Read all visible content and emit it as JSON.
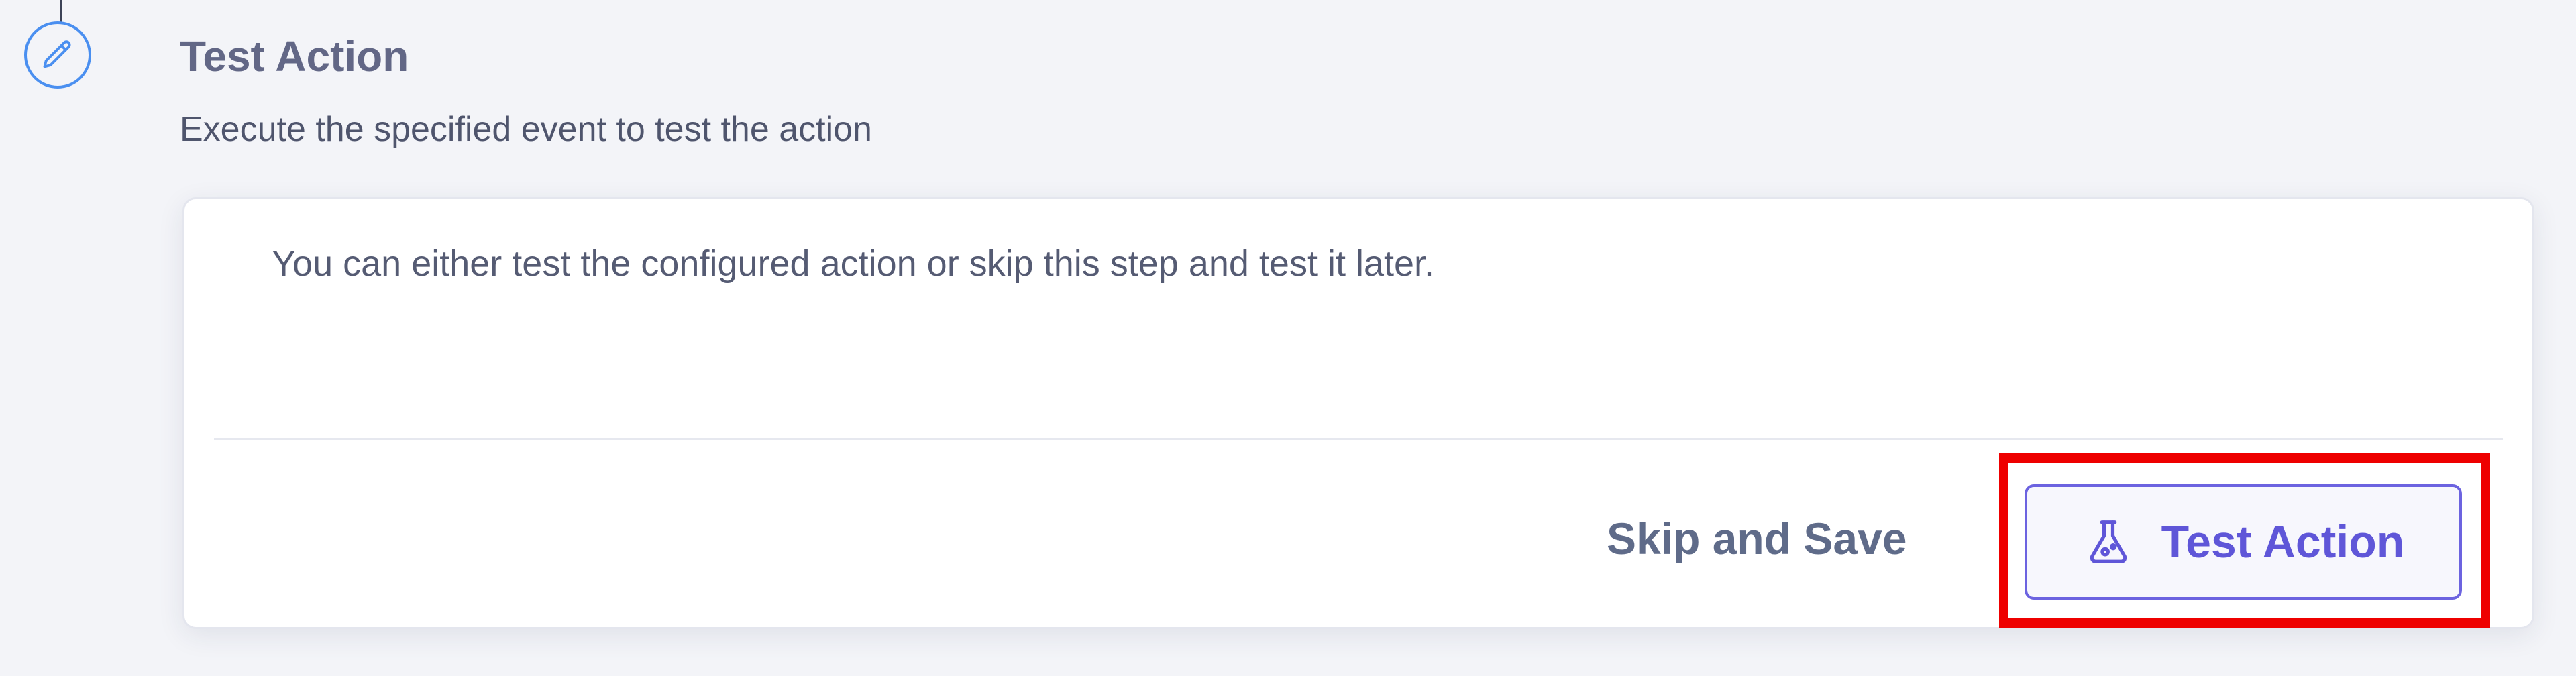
{
  "step": {
    "title": "Test Action",
    "subtitle": "Execute the specified event to test the action",
    "icon": "pencil-icon"
  },
  "card": {
    "message": "You can either test the configured action or skip this step and test it later."
  },
  "actions": {
    "skip_label": "Skip and Save",
    "test_label": "Test Action",
    "test_icon": "flask-icon"
  },
  "colors": {
    "accent": "#5f56d8",
    "step_icon": "#4a8ff0",
    "highlight": "#ee0000"
  }
}
